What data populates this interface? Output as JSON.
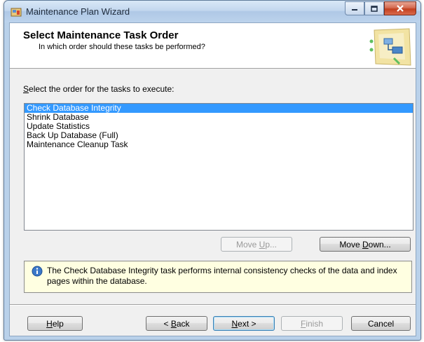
{
  "window": {
    "title": "Maintenance Plan Wizard"
  },
  "header": {
    "title": "Select Maintenance Task Order",
    "subtitle": "In which order should these tasks be performed?"
  },
  "prompt": {
    "prefix": "S",
    "rest": "elect the order for the tasks to execute:"
  },
  "tasks": [
    "Check Database Integrity",
    "Shrink Database",
    "Update Statistics",
    "Back Up Database (Full)",
    "Maintenance Cleanup Task"
  ],
  "selected_task_index": 0,
  "move_up": {
    "pre": "Move ",
    "key": "U",
    "post": "p...",
    "enabled": false
  },
  "move_down": {
    "pre": "Move ",
    "key": "D",
    "post": "own...",
    "enabled": true
  },
  "info": {
    "icon": "info-icon",
    "text": "The Check Database Integrity task performs internal consistency checks of the data and index pages within the database."
  },
  "footer": {
    "help": {
      "pre": "",
      "key": "H",
      "post": "elp"
    },
    "back": {
      "pre": "< ",
      "key": "B",
      "post": "ack"
    },
    "next": {
      "pre": "",
      "key": "N",
      "post": "ext >"
    },
    "finish": {
      "pre": "",
      "key": "F",
      "post": "inish",
      "enabled": false
    },
    "cancel": {
      "label": "Cancel"
    }
  },
  "colors": {
    "selection": "#3399ff",
    "info_background": "#ffffe1",
    "frame": "#b9d1ea"
  }
}
